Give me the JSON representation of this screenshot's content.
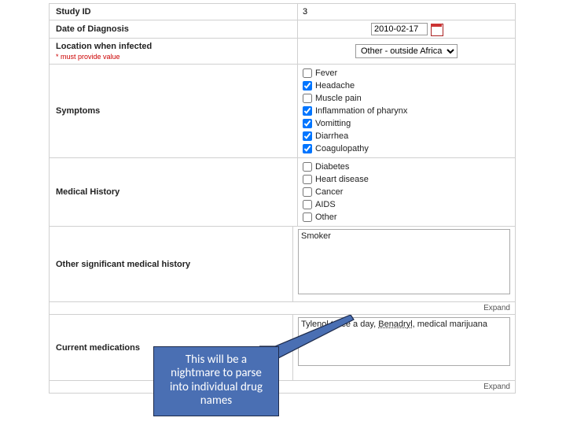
{
  "rows": {
    "study_id": {
      "label": "Study ID",
      "value": "3"
    },
    "diagnosis_date": {
      "label": "Date of Diagnosis",
      "value": "2010-02-17"
    },
    "location": {
      "label": "Location when infected",
      "required_note": "* must provide value",
      "selected": "Other - outside Africa"
    },
    "symptoms": {
      "label": "Symptoms",
      "options": [
        {
          "label": "Fever",
          "checked": false
        },
        {
          "label": "Headache",
          "checked": true
        },
        {
          "label": "Muscle pain",
          "checked": false
        },
        {
          "label": "Inflammation of pharynx",
          "checked": true
        },
        {
          "label": "Vomitting",
          "checked": true
        },
        {
          "label": "Diarrhea",
          "checked": true
        },
        {
          "label": "Coagulopathy",
          "checked": true
        }
      ]
    },
    "medical_history": {
      "label": "Medical History",
      "options": [
        {
          "label": "Diabetes",
          "checked": false
        },
        {
          "label": "Heart disease",
          "checked": false
        },
        {
          "label": "Cancer",
          "checked": false
        },
        {
          "label": "AIDS",
          "checked": false
        },
        {
          "label": "Other",
          "checked": false
        }
      ]
    },
    "other_history": {
      "label": "Other significant medical history",
      "value": "Smoker"
    },
    "current_meds": {
      "label": "Current medications",
      "value_prefix": "Tylenol twice a day, ",
      "value_underlined": "Benadryl",
      "value_suffix": ", medical marijuana"
    }
  },
  "expand_label": "Expand",
  "callout_text": "This will be a nightmare to parse into individual drug names"
}
